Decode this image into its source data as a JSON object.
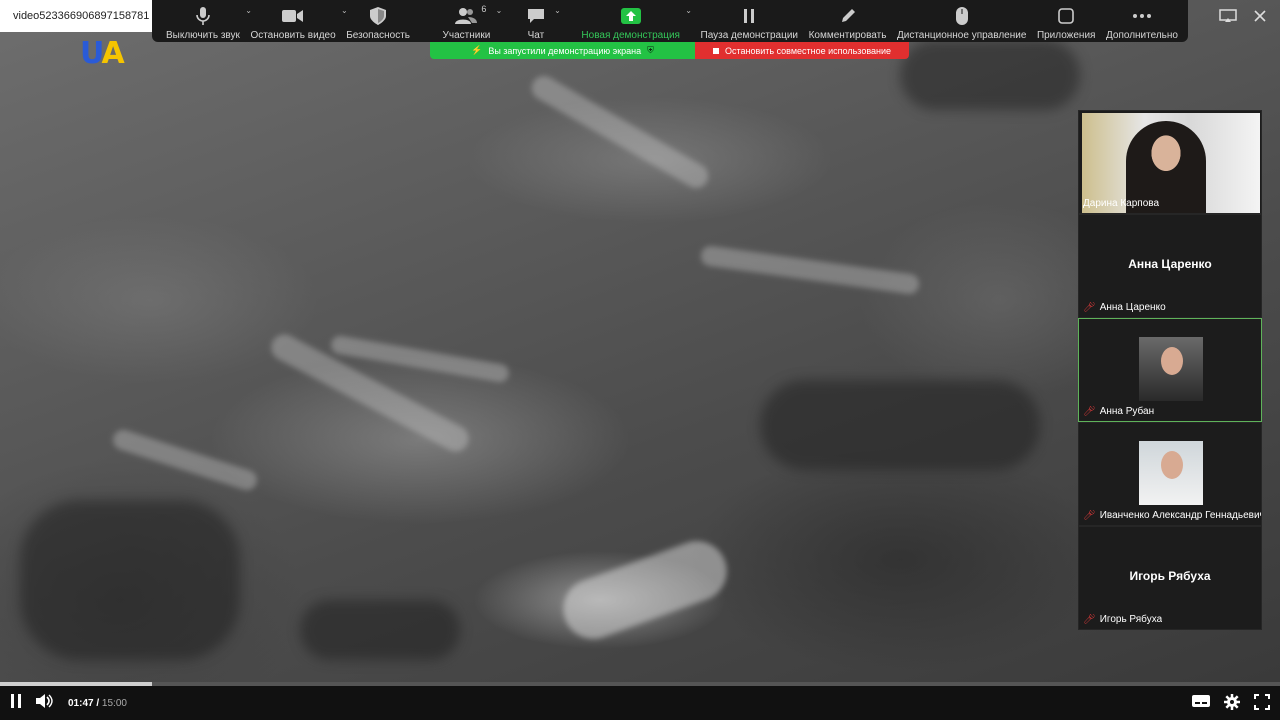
{
  "window": {
    "title": "video523366906897158781"
  },
  "toolbar": {
    "items": [
      {
        "label": "Выключить звук",
        "icon": "microphone-icon"
      },
      {
        "label": "Остановить видео",
        "icon": "video-camera-icon"
      },
      {
        "label": "Безопасность",
        "icon": "shield-icon"
      },
      {
        "label": "Участники",
        "icon": "participants-icon",
        "count": "6"
      },
      {
        "label": "Чат",
        "icon": "chat-icon"
      },
      {
        "label": "Новая демонстрация",
        "icon": "share-screen-icon"
      },
      {
        "label": "Пауза демонстрации",
        "icon": "pause-icon"
      },
      {
        "label": "Комментировать",
        "icon": "pencil-icon"
      },
      {
        "label": "Дистанционное управление",
        "icon": "mouse-icon"
      },
      {
        "label": "Приложения",
        "icon": "apps-icon"
      },
      {
        "label": "Дополнительно",
        "icon": "more-icon"
      }
    ]
  },
  "share": {
    "status_label": "Вы запустили демонстрацию экрана",
    "stop_label": "Остановить совместное использование"
  },
  "logo": {
    "u": "U",
    "a": "A"
  },
  "participants": [
    {
      "name": "Дарина Карпова",
      "type": "camera"
    },
    {
      "name": "Анна Царенко",
      "type": "name-only",
      "muted": true
    },
    {
      "name": "Анна Рубан",
      "type": "photo",
      "muted": true,
      "active": true
    },
    {
      "name": "Иванченко Александр Геннадьевич",
      "type": "photo",
      "muted": true
    },
    {
      "name": "Игорь Рябуха",
      "type": "name-only",
      "muted": true
    }
  ],
  "player": {
    "current_time": "01:47",
    "separator": "/",
    "duration": "15:00",
    "progress_fraction": 0.119
  },
  "colors": {
    "share_green": "#23c244",
    "stop_red": "#e12f2f",
    "active_border": "#5fb35a"
  }
}
